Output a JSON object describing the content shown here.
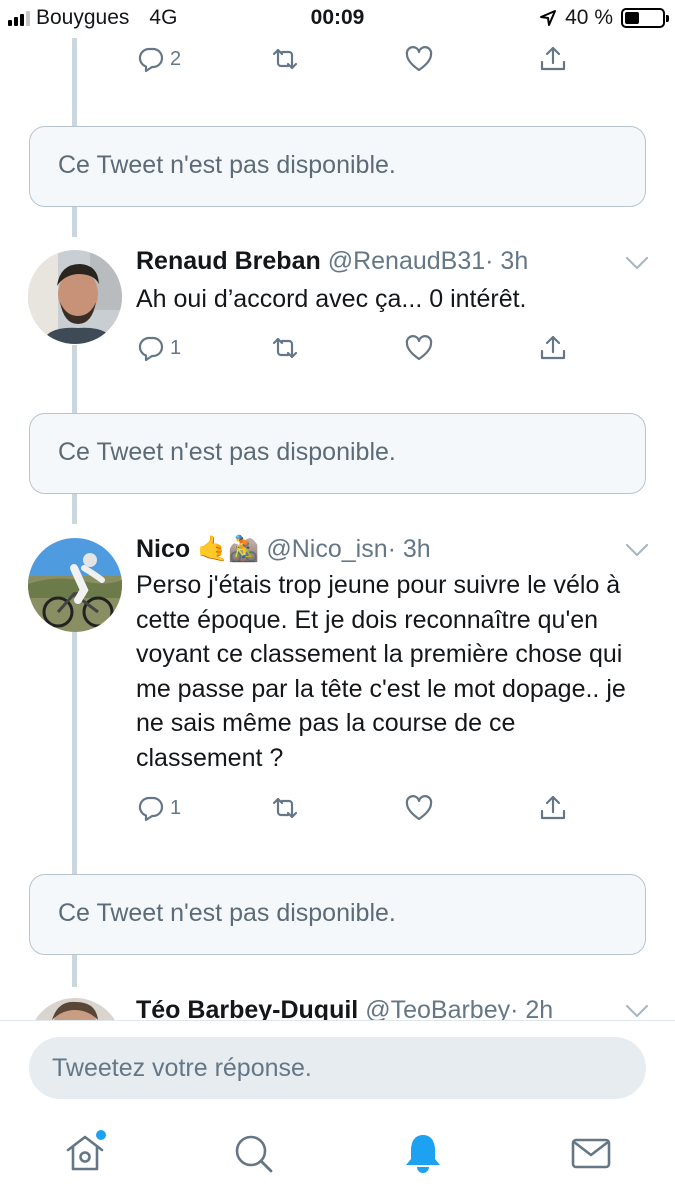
{
  "status_bar": {
    "carrier": "Bouygues",
    "network": "4G",
    "time": "00:09",
    "battery": "40 %",
    "battery_level": 0.4
  },
  "top_actions": {
    "reply_count": "2",
    "retweet_count": "",
    "like_count": ""
  },
  "unavailable_text": "Ce Tweet n'est pas disponible.",
  "tweets": [
    {
      "name": "Renaud Breban",
      "handle": "@RenaudB31",
      "time": "· 3h",
      "text": "Ah oui d’accord avec ça... 0 intérêt.",
      "reply_count": "1"
    },
    {
      "name": "Nico",
      "emojis": "🤙🚵",
      "handle": "@Nico_isn",
      "time": "· 3h",
      "text": "Perso j'étais trop jeune pour suivre le vélo à cette époque. Et je dois reconnaître qu'en voyant ce classement la première chose qui me passe par la tête c'est le mot dopage.. je ne sais même pas la course de ce classement ?",
      "reply_count": "1"
    },
    {
      "name": "Téo Barbey-Duquil",
      "handle": "@TeoBarbey",
      "time": "· 2h"
    }
  ],
  "reply": {
    "placeholder": "Tweetez votre réponse."
  },
  "tabs": [
    {
      "icon": "home-icon",
      "active": false,
      "badge": true
    },
    {
      "icon": "search-icon",
      "active": false
    },
    {
      "icon": "bell-icon",
      "active": true
    },
    {
      "icon": "mail-icon",
      "active": false
    }
  ],
  "colors": {
    "accent": "#1da1f2",
    "muted": "#657786",
    "thread": "#ccd6dd"
  }
}
